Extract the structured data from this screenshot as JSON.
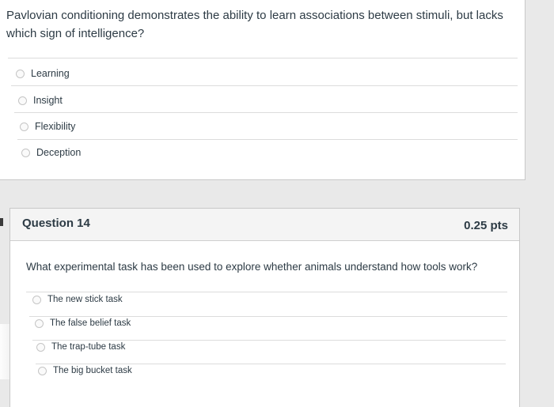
{
  "previous_question": {
    "text": "Pavlovian conditioning demonstrates the ability to learn associations between stimuli, but lacks which sign of intelligence?",
    "answers": [
      "Learning",
      "Insight",
      "Flexibility",
      "Deception"
    ]
  },
  "current_question": {
    "title": "Question 14",
    "points": "0.25 pts",
    "text": "What experimental task has been used to explore whether animals understand how tools work?",
    "answers": [
      "The new stick task",
      "The false belief task",
      "The trap-tube task",
      "The big bucket task"
    ]
  }
}
